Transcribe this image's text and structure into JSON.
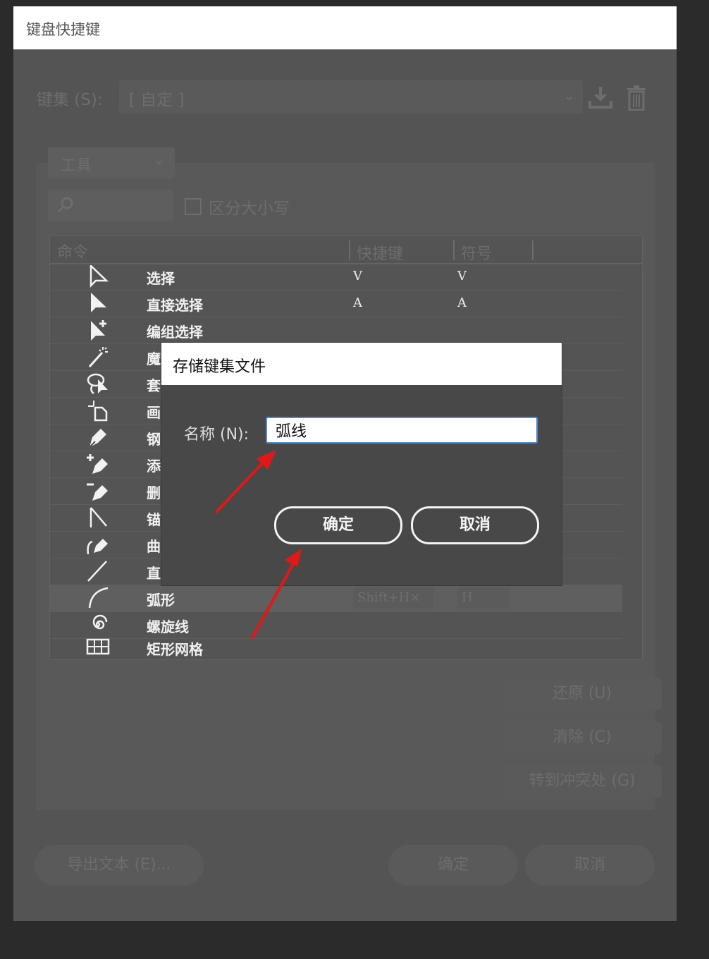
{
  "window": {
    "title": "键盘快捷键"
  },
  "keyset": {
    "label": "键集 (S):",
    "value": "[ 自定 ]"
  },
  "category": {
    "value": "工具"
  },
  "search": {
    "placeholder": "",
    "case_label": "区分大小写"
  },
  "table": {
    "headers": {
      "command": "命令",
      "shortcut": "快捷键",
      "symbol": "符号"
    },
    "rows": [
      {
        "icon": "selection-arrow-icon",
        "name": "选择",
        "key": "V",
        "sym": "V"
      },
      {
        "icon": "direct-selection-icon",
        "name": "直接选择",
        "key": "A",
        "sym": "A"
      },
      {
        "icon": "group-selection-icon",
        "name": "编组选择",
        "key": "",
        "sym": ""
      },
      {
        "icon": "magic-wand-icon",
        "name": "魔",
        "key": "",
        "sym": ""
      },
      {
        "icon": "lasso-icon",
        "name": "套",
        "key": "",
        "sym": ""
      },
      {
        "icon": "artboard-icon",
        "name": "画",
        "key": "",
        "sym": ""
      },
      {
        "icon": "pen-icon",
        "name": "钢",
        "key": "",
        "sym": ""
      },
      {
        "icon": "add-anchor-icon",
        "name": "添",
        "key": "",
        "sym": ""
      },
      {
        "icon": "delete-anchor-icon",
        "name": "删",
        "key": "",
        "sym": ""
      },
      {
        "icon": "anchor-point-icon",
        "name": "锚",
        "key": "",
        "sym": ""
      },
      {
        "icon": "curvature-icon",
        "name": "曲",
        "key": "",
        "sym": ""
      },
      {
        "icon": "line-segment-icon",
        "name": "直",
        "key": "",
        "sym": ""
      },
      {
        "icon": "arc-icon",
        "name": "弧形",
        "key": "Shift+H×",
        "sym": "H",
        "selected": true
      },
      {
        "icon": "spiral-icon",
        "name": "螺旋线",
        "key": "",
        "sym": ""
      },
      {
        "icon": "rectangular-grid-icon",
        "name": "矩形网格",
        "key": "",
        "sym": ""
      }
    ]
  },
  "side_buttons": {
    "restore": "还原 (U)",
    "clear": "清除 (C)",
    "goto_conflict": "转到冲突处 (G)"
  },
  "footer": {
    "export": "导出文本 (E)...",
    "ok": "确定",
    "cancel": "取消"
  },
  "save_dialog": {
    "title": "存储键集文件",
    "name_label": "名称 (N):",
    "name_value": "弧线",
    "ok": "确定",
    "cancel": "取消"
  },
  "colors": {
    "annotation_arrow": "#e01818",
    "input_focus": "#4a8bd6"
  }
}
